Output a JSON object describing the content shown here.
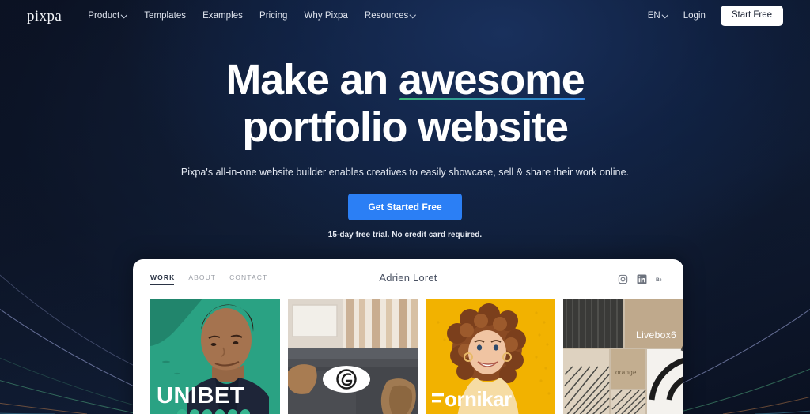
{
  "brand": {
    "logo_text": "pixpa"
  },
  "topnav": {
    "links": [
      {
        "label": "Product",
        "has_chevron": true
      },
      {
        "label": "Templates",
        "has_chevron": false
      },
      {
        "label": "Examples",
        "has_chevron": false
      },
      {
        "label": "Pricing",
        "has_chevron": false
      },
      {
        "label": "Why Pixpa",
        "has_chevron": false
      },
      {
        "label": "Resources",
        "has_chevron": true
      }
    ],
    "language": "EN",
    "login_label": "Login",
    "start_free_label": "Start Free"
  },
  "hero": {
    "headline_line1_prefix": "Make an ",
    "headline_line1_highlight": "awesome",
    "headline_line2": "portfolio website",
    "subheadline": "Pixpa's all-in-one website builder enables creatives to easily showcase, sell & share their work online.",
    "cta_label": "Get Started Free",
    "trial_note": "15-day free trial. No credit card required.",
    "underline_gradient_start": "#3cb878",
    "underline_gradient_end": "#2b7fe0",
    "cta_color": "#2b7ff5"
  },
  "mockup": {
    "nav": [
      {
        "label": "WORK",
        "active": true
      },
      {
        "label": "ABOUT",
        "active": false
      },
      {
        "label": "CONTACT",
        "active": false
      }
    ],
    "site_title": "Adrien Loret",
    "socials": [
      {
        "name": "instagram-icon",
        "label": "Instagram"
      },
      {
        "name": "linkedin-icon",
        "label": "LinkedIn"
      },
      {
        "name": "behance-icon",
        "label": "Behance"
      }
    ],
    "gallery": [
      {
        "name": "unibet",
        "label": "UNIBET",
        "bg": "#2aa283"
      },
      {
        "name": "interior",
        "label": "",
        "bg": "#b9ada2"
      },
      {
        "name": "ornikar",
        "label": "ornikar",
        "bg": "#f2b200"
      },
      {
        "name": "livebox",
        "label": "Livebox6",
        "sublabel": "orange",
        "bg": "#cbbda9"
      }
    ]
  },
  "decorations": {
    "arc_colors": [
      "#9aa3d6",
      "#4ea97e",
      "#c4804a",
      "#4fa6c4"
    ]
  }
}
